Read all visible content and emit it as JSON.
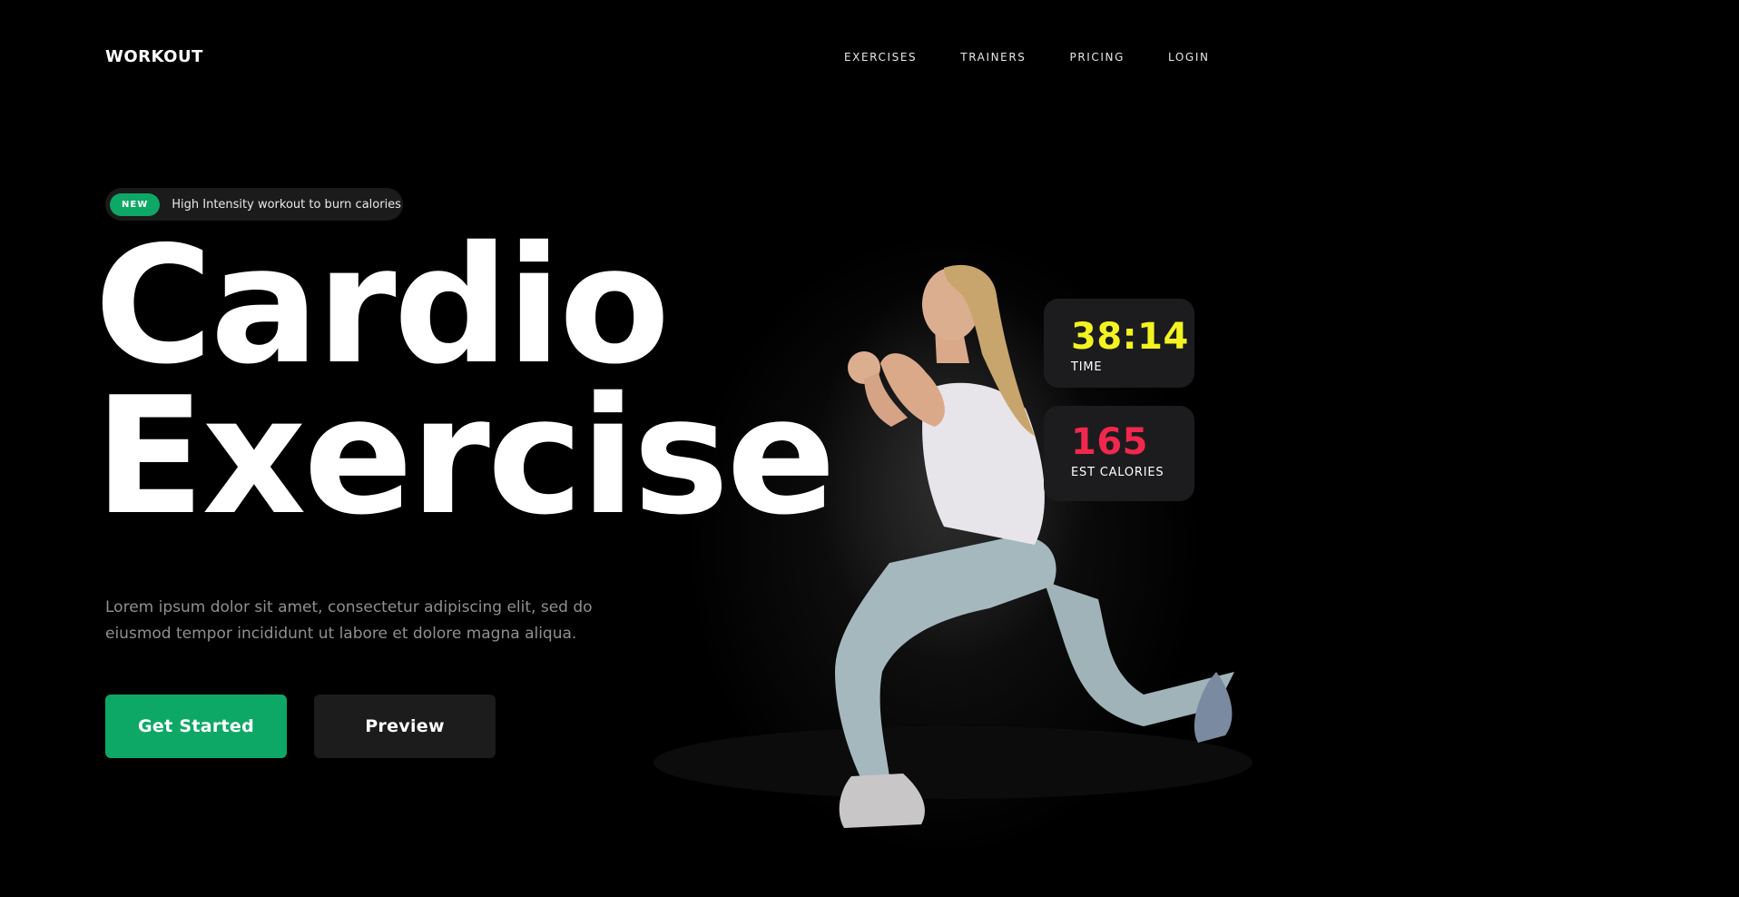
{
  "header": {
    "brand": "WORKOUT",
    "nav": [
      "EXERCISES",
      "TRAINERS",
      "PRICING",
      "LOGIN"
    ]
  },
  "hero": {
    "badge_tag": "NEW",
    "badge_text": "High Intensity workout to burn calories",
    "title_line1": "Cardio",
    "title_line2": "Exercise",
    "description": "Lorem ipsum dolor sit amet, consectetur adipiscing elit, sed do eiusmod tempor incididunt ut labore et dolore magna aliqua.",
    "primary_button": "Get Started",
    "secondary_button": "Preview"
  },
  "stats": {
    "time_value": "38:14",
    "time_label": "TIME",
    "calories_value": "165",
    "calories_label": "EST CALORIES"
  },
  "colors": {
    "background": "#000000",
    "accent_green": "#0ea866",
    "time_yellow": "#f3f321",
    "calories_red": "#f0284d",
    "card": "#1c1c1e"
  },
  "icons": {
    "hero_image": "athlete-lunge-photo"
  }
}
